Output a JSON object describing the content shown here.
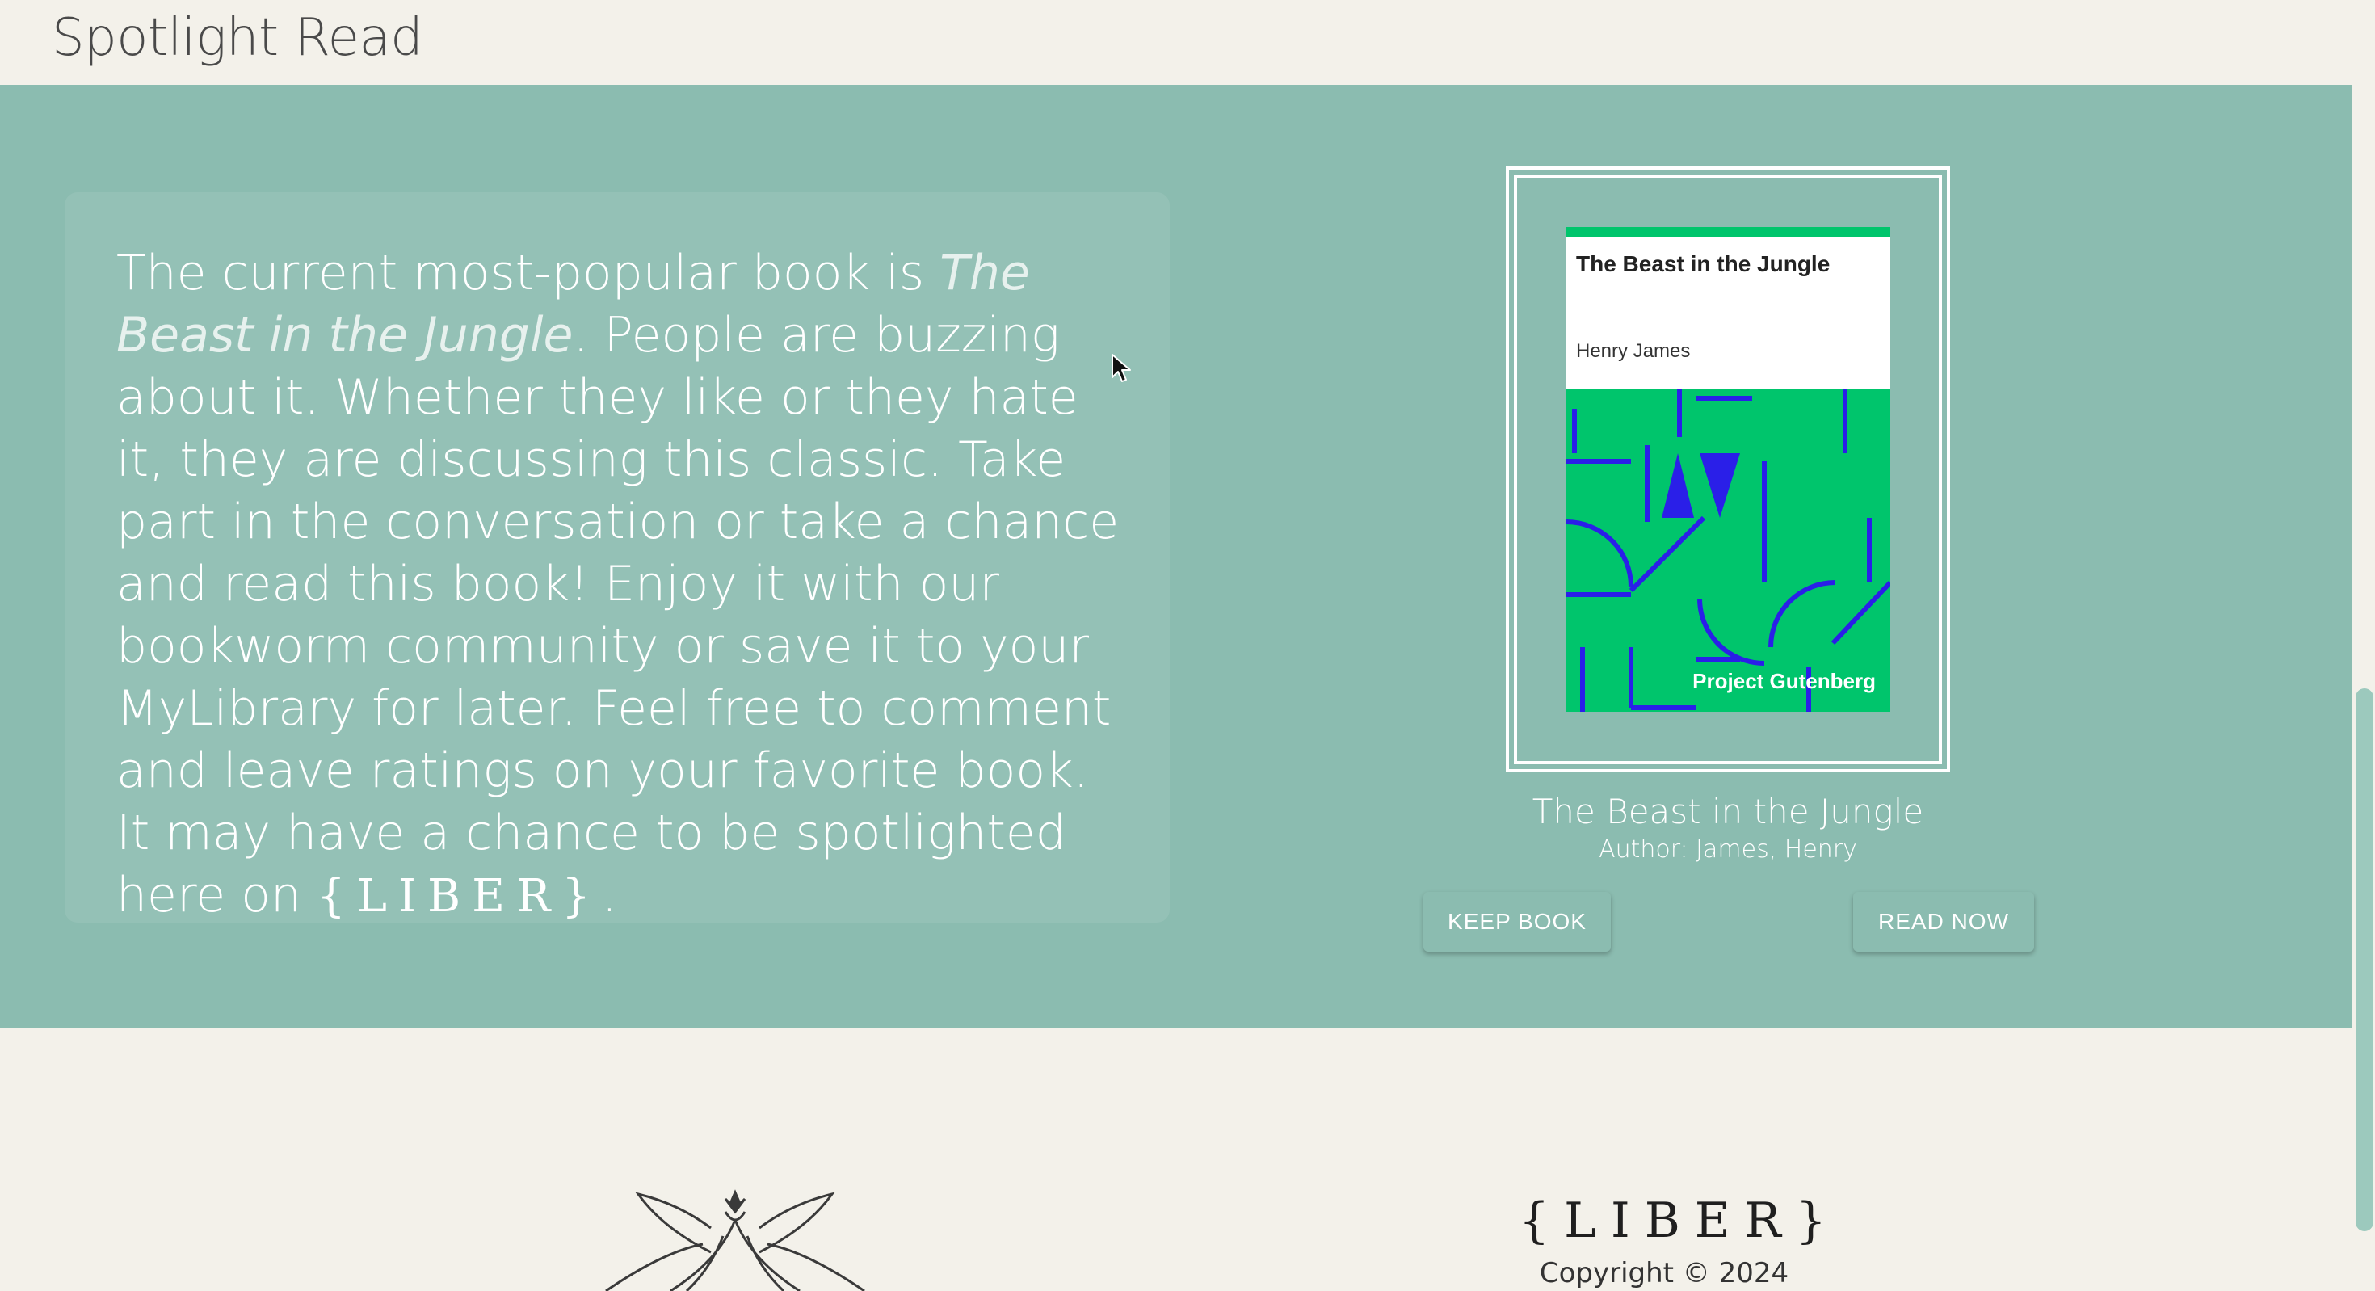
{
  "section": {
    "title": "Spotlight Read"
  },
  "blurb": {
    "intro": "The current most-popular book is ",
    "book_italic": "The Beast in the Jungle",
    "body": ". People are buzzing about it. Whether they like or they hate it, they are discussing this classic. Take part in the conversation or take a chance and read this book! Enjoy it with our bookworm community or save it to your MyLibrary for later. Feel free to comment and leave ratings on your favorite book. It may have a chance to be spotlighted here on ",
    "brand": "{LIBER}",
    "end": "."
  },
  "cover": {
    "title": "The Beast in the Jungle",
    "author": "Henry James",
    "publisher": "Project Gutenberg",
    "colors": {
      "background": "#00c56c",
      "pattern": "#2a1fe8"
    }
  },
  "book": {
    "title": "The Beast in the Jungle",
    "author_line": "Author: James, Henry"
  },
  "actions": {
    "keep_label": "KEEP BOOK",
    "read_label": "READ NOW"
  },
  "footer": {
    "brand": "{LIBER}",
    "copyright": "Copyright © 2024"
  },
  "colors": {
    "band": "#8bbcb0",
    "page_background": "#f3f1ea",
    "text_dark": "#4a4a4a"
  },
  "icons": {
    "cursor": "arrow-cursor-icon",
    "footer_logo": "ornamental-crown-logo-icon"
  }
}
